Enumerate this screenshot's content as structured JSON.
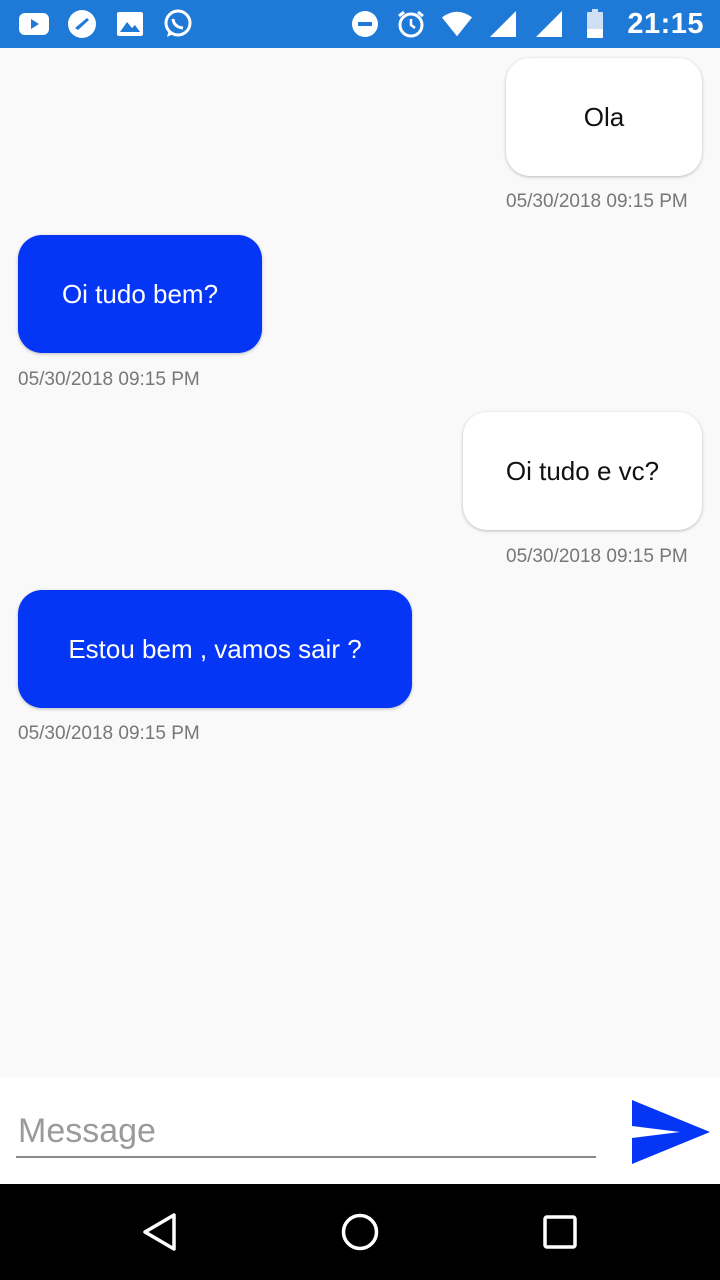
{
  "status_bar": {
    "left_icons": [
      "youtube-icon",
      "messaging-app-icon",
      "gallery-icon",
      "whatsapp-icon"
    ],
    "right_icons": [
      "do-not-disturb-icon",
      "alarm-icon",
      "wifi-icon",
      "signal-icon",
      "battery-icon"
    ],
    "time": "21:15"
  },
  "messages": [
    {
      "text": "Ola",
      "timestamp": "05/30/2018 09:15 PM",
      "direction": "sent"
    },
    {
      "text": "Oi tudo bem?",
      "timestamp": "05/30/2018 09:15 PM",
      "direction": "received"
    },
    {
      "text": "Oi tudo e vc?",
      "timestamp": "05/30/2018 09:15 PM",
      "direction": "sent"
    },
    {
      "text": "Estou bem , vamos sair ?",
      "timestamp": "05/30/2018 09:15 PM",
      "direction": "received"
    }
  ],
  "composer": {
    "placeholder": "Message",
    "value": "",
    "send_icon": "send-icon"
  },
  "nav_bar": {
    "icons": [
      "back-icon",
      "home-icon",
      "recents-icon"
    ]
  },
  "colors": {
    "status_bar": "#1f7ad7",
    "received_bubble": "#0535f5",
    "sent_bubble": "#ffffff",
    "background": "#f9f9fa",
    "send_icon": "#0535f5"
  }
}
